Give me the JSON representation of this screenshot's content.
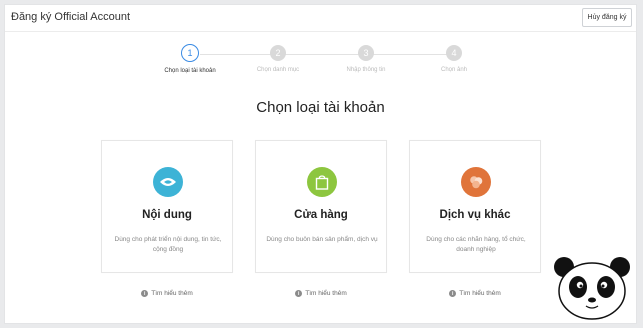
{
  "header": {
    "title": "Đăng ký Official Account",
    "cancel_label": "Hủy đăng ký"
  },
  "steps": [
    {
      "number": "1",
      "label": "Chọn loại tài khoản",
      "active": true
    },
    {
      "number": "2",
      "label": "Chọn danh mục",
      "active": false
    },
    {
      "number": "3",
      "label": "Nhập thông tin",
      "active": false
    },
    {
      "number": "4",
      "label": "Chọn ảnh",
      "active": false
    }
  ],
  "main": {
    "heading": "Chọn loại tài khoản",
    "learn_more": "Tìm hiểu thêm",
    "cards": [
      {
        "title": "Nội dung",
        "desc": "Dùng cho phát triển nội dung, tin tức, cộng đồng",
        "icon": "content-icon",
        "color": "#3db3d6"
      },
      {
        "title": "Cửa hàng",
        "desc": "Dùng cho buôn bán sản phẩm, dịch vụ",
        "icon": "shop-bag-icon",
        "color": "#8dc63f"
      },
      {
        "title": "Dịch vụ khác",
        "desc": "Dùng cho các nhãn hàng, tổ chức, doanh nghiệp",
        "icon": "services-icon",
        "color": "#e0743a"
      }
    ]
  },
  "colors": {
    "accent": "#3a8be4",
    "inactive_step": "#d9d9d9"
  }
}
